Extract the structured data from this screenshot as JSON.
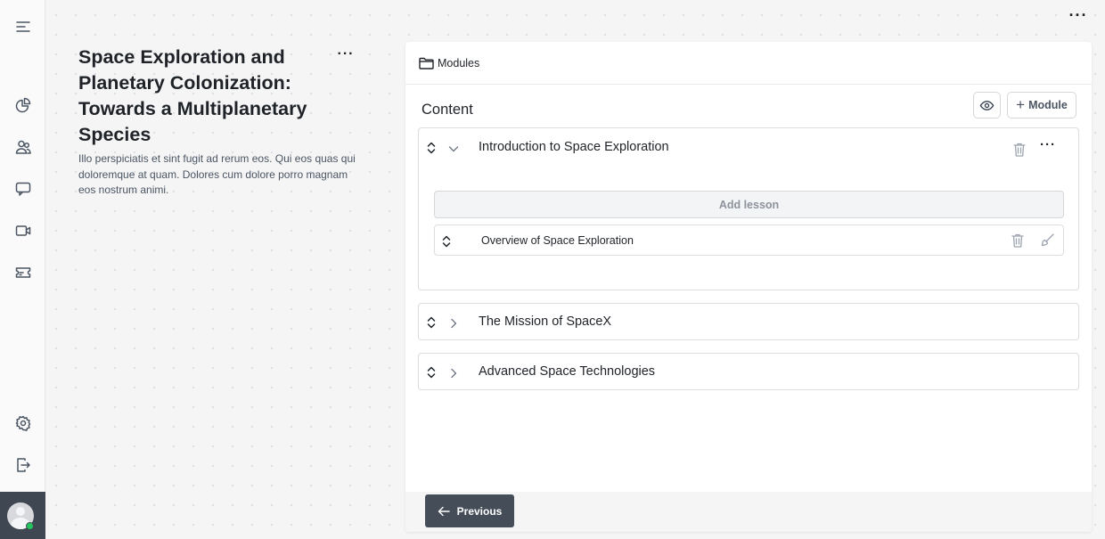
{
  "topbar": {
    "more_icon": "more-horizontal-icon",
    "more_label": "···"
  },
  "sidebar": {
    "items": [
      {
        "name": "menu",
        "icon": "menu-icon"
      },
      {
        "name": "analytics",
        "icon": "pie-chart-icon"
      },
      {
        "name": "users",
        "icon": "users-icon"
      },
      {
        "name": "messages",
        "icon": "chat-icon"
      },
      {
        "name": "video",
        "icon": "video-icon"
      },
      {
        "name": "tickets",
        "icon": "ticket-icon"
      },
      {
        "name": "settings",
        "icon": "gear-icon"
      },
      {
        "name": "logout",
        "icon": "logout-icon"
      }
    ],
    "avatar_status_color": "#22c55e"
  },
  "course": {
    "title": "Space Exploration and Planetary Colonization: Towards a Multiplanetary Species",
    "more_label": "···",
    "description": "Illo perspiciatis et sint fugit ad rerum eos. Qui eos quas qui doloremque at quam. Dolores cum dolore porro magnam eos nostrum animi."
  },
  "panel": {
    "header_label": "Modules",
    "content_title": "Content",
    "add_module_label": "Module",
    "add_module_plus": "+",
    "modules": [
      {
        "title": "Introduction to Space Exploration",
        "expanded": true,
        "more_label": "···",
        "add_lesson_label": "Add lesson",
        "lessons": [
          {
            "title": "Overview of Space Exploration"
          }
        ]
      },
      {
        "title": "The Mission of SpaceX",
        "expanded": false
      },
      {
        "title": "Advanced Space Technologies",
        "expanded": false
      }
    ],
    "footer": {
      "previous_label": "Previous"
    }
  },
  "colors": {
    "primary_button": "#454d58",
    "background": "#f5f5f6",
    "text": "#1f2328"
  }
}
